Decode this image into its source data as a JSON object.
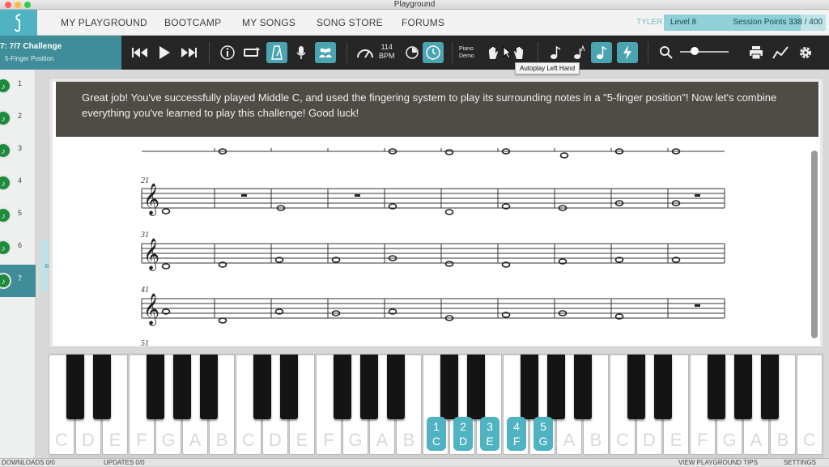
{
  "window": {
    "title": "Playground"
  },
  "nav": {
    "items": [
      "MY PLAYGROUND",
      "BOOTCAMP",
      "MY SONGS",
      "SONG STORE",
      "FORUMS"
    ],
    "user": "TYLER",
    "level": "Level 8",
    "session_points": "Session Points 338 / 400",
    "progress_fraction": 0.845
  },
  "lesson": {
    "title": "7: 7/7 Challenge",
    "subtitle": "5-Finger Position"
  },
  "toolbar": {
    "bpm_value": "114",
    "bpm_label": "BPM",
    "piano_demo": [
      "Piano",
      "Demo"
    ],
    "tooltip": "Autoplay Left Hand"
  },
  "sidebar": {
    "steps": [
      "1",
      "2",
      "3",
      "4",
      "5",
      "6",
      "7"
    ],
    "active_step": "7"
  },
  "message": "Great job! You've successfully played Middle C, and used the fingering system to play its surrounding notes in a \"5-finger position\"! Now let's combine everything you've learned to play this challenge! Good luck!",
  "score": {
    "measure_numbers": [
      "21",
      "31",
      "41",
      "51"
    ]
  },
  "keyboard": {
    "white_keys": [
      "C",
      "D",
      "E",
      "F",
      "G",
      "A",
      "B",
      "C",
      "D",
      "E",
      "F",
      "G",
      "A",
      "B",
      "C",
      "D",
      "E",
      "F",
      "G",
      "A",
      "B",
      "C",
      "D",
      "E",
      "F",
      "G",
      "A",
      "B",
      "C"
    ],
    "fingers": [
      {
        "num": "1",
        "note": "C"
      },
      {
        "num": "2",
        "note": "D"
      },
      {
        "num": "3",
        "note": "E"
      },
      {
        "num": "4",
        "note": "F"
      },
      {
        "num": "5",
        "note": "G"
      }
    ]
  },
  "bottom_bar": {
    "downloads": "DOWNLOADS 0/0",
    "updates": "UPDATES 0/0",
    "tips": "VIEW PLAYGROUND TIPS",
    "settings": "SETTINGS"
  },
  "colors": {
    "accent": "#4fb3c2",
    "toolbar": "#262626",
    "message_bg": "#4f4b45",
    "step_icon": "#1d8a3c"
  }
}
